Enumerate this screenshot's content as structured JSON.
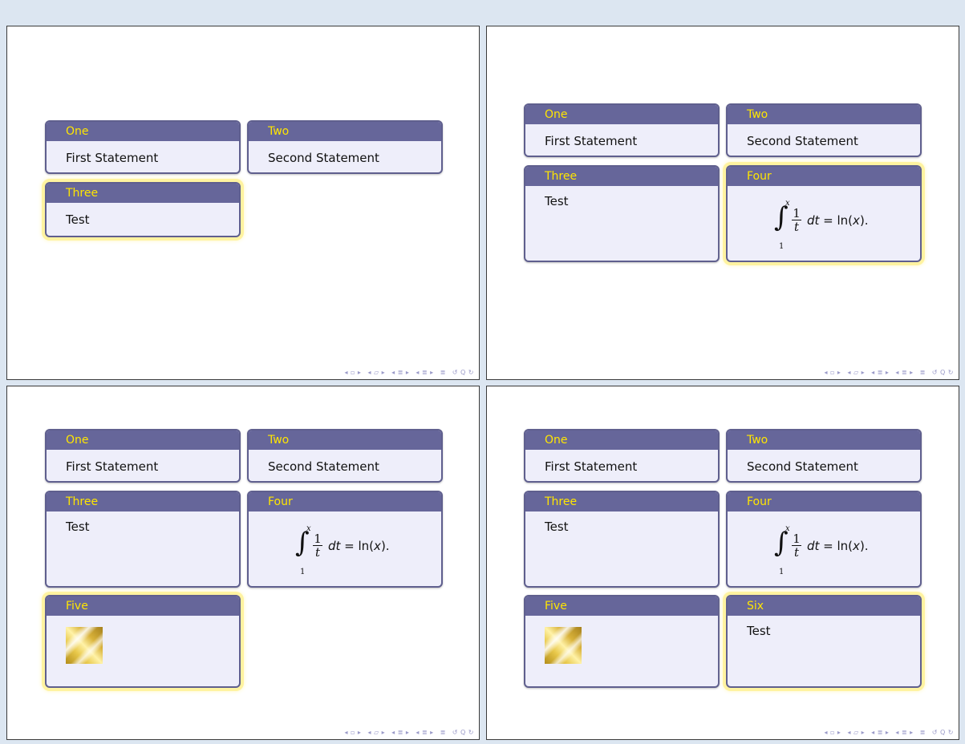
{
  "blocks": {
    "one": {
      "title": "One",
      "body": "First Statement"
    },
    "two": {
      "title": "Two",
      "body": "Second Statement"
    },
    "three": {
      "title": "Three",
      "body": "Test"
    },
    "four": {
      "title": "Four"
    },
    "five": {
      "title": "Five"
    },
    "six": {
      "title": "Six",
      "body": "Test"
    }
  },
  "math": {
    "upper": "x",
    "lower": "1",
    "numerator": "1",
    "denominator": "t",
    "rest_var": "dt",
    "rest_eq": " = ln(",
    "rest_x": "x",
    "rest_end": ")."
  },
  "nav": {
    "icons": [
      "◂",
      "▫",
      "▸",
      "◂",
      "▱",
      "▸",
      "◂",
      "≣",
      "▸",
      "◂",
      "≣",
      "▸",
      "≣",
      "↺",
      "Q",
      "↻"
    ]
  },
  "colors": {
    "title_bar": "#66669a",
    "title_text": "#ffe600",
    "block_body": "#eeeefa",
    "highlight": "#fff3a0",
    "background": "#dce6f1"
  },
  "images": {
    "five": "gold-texture-image"
  }
}
